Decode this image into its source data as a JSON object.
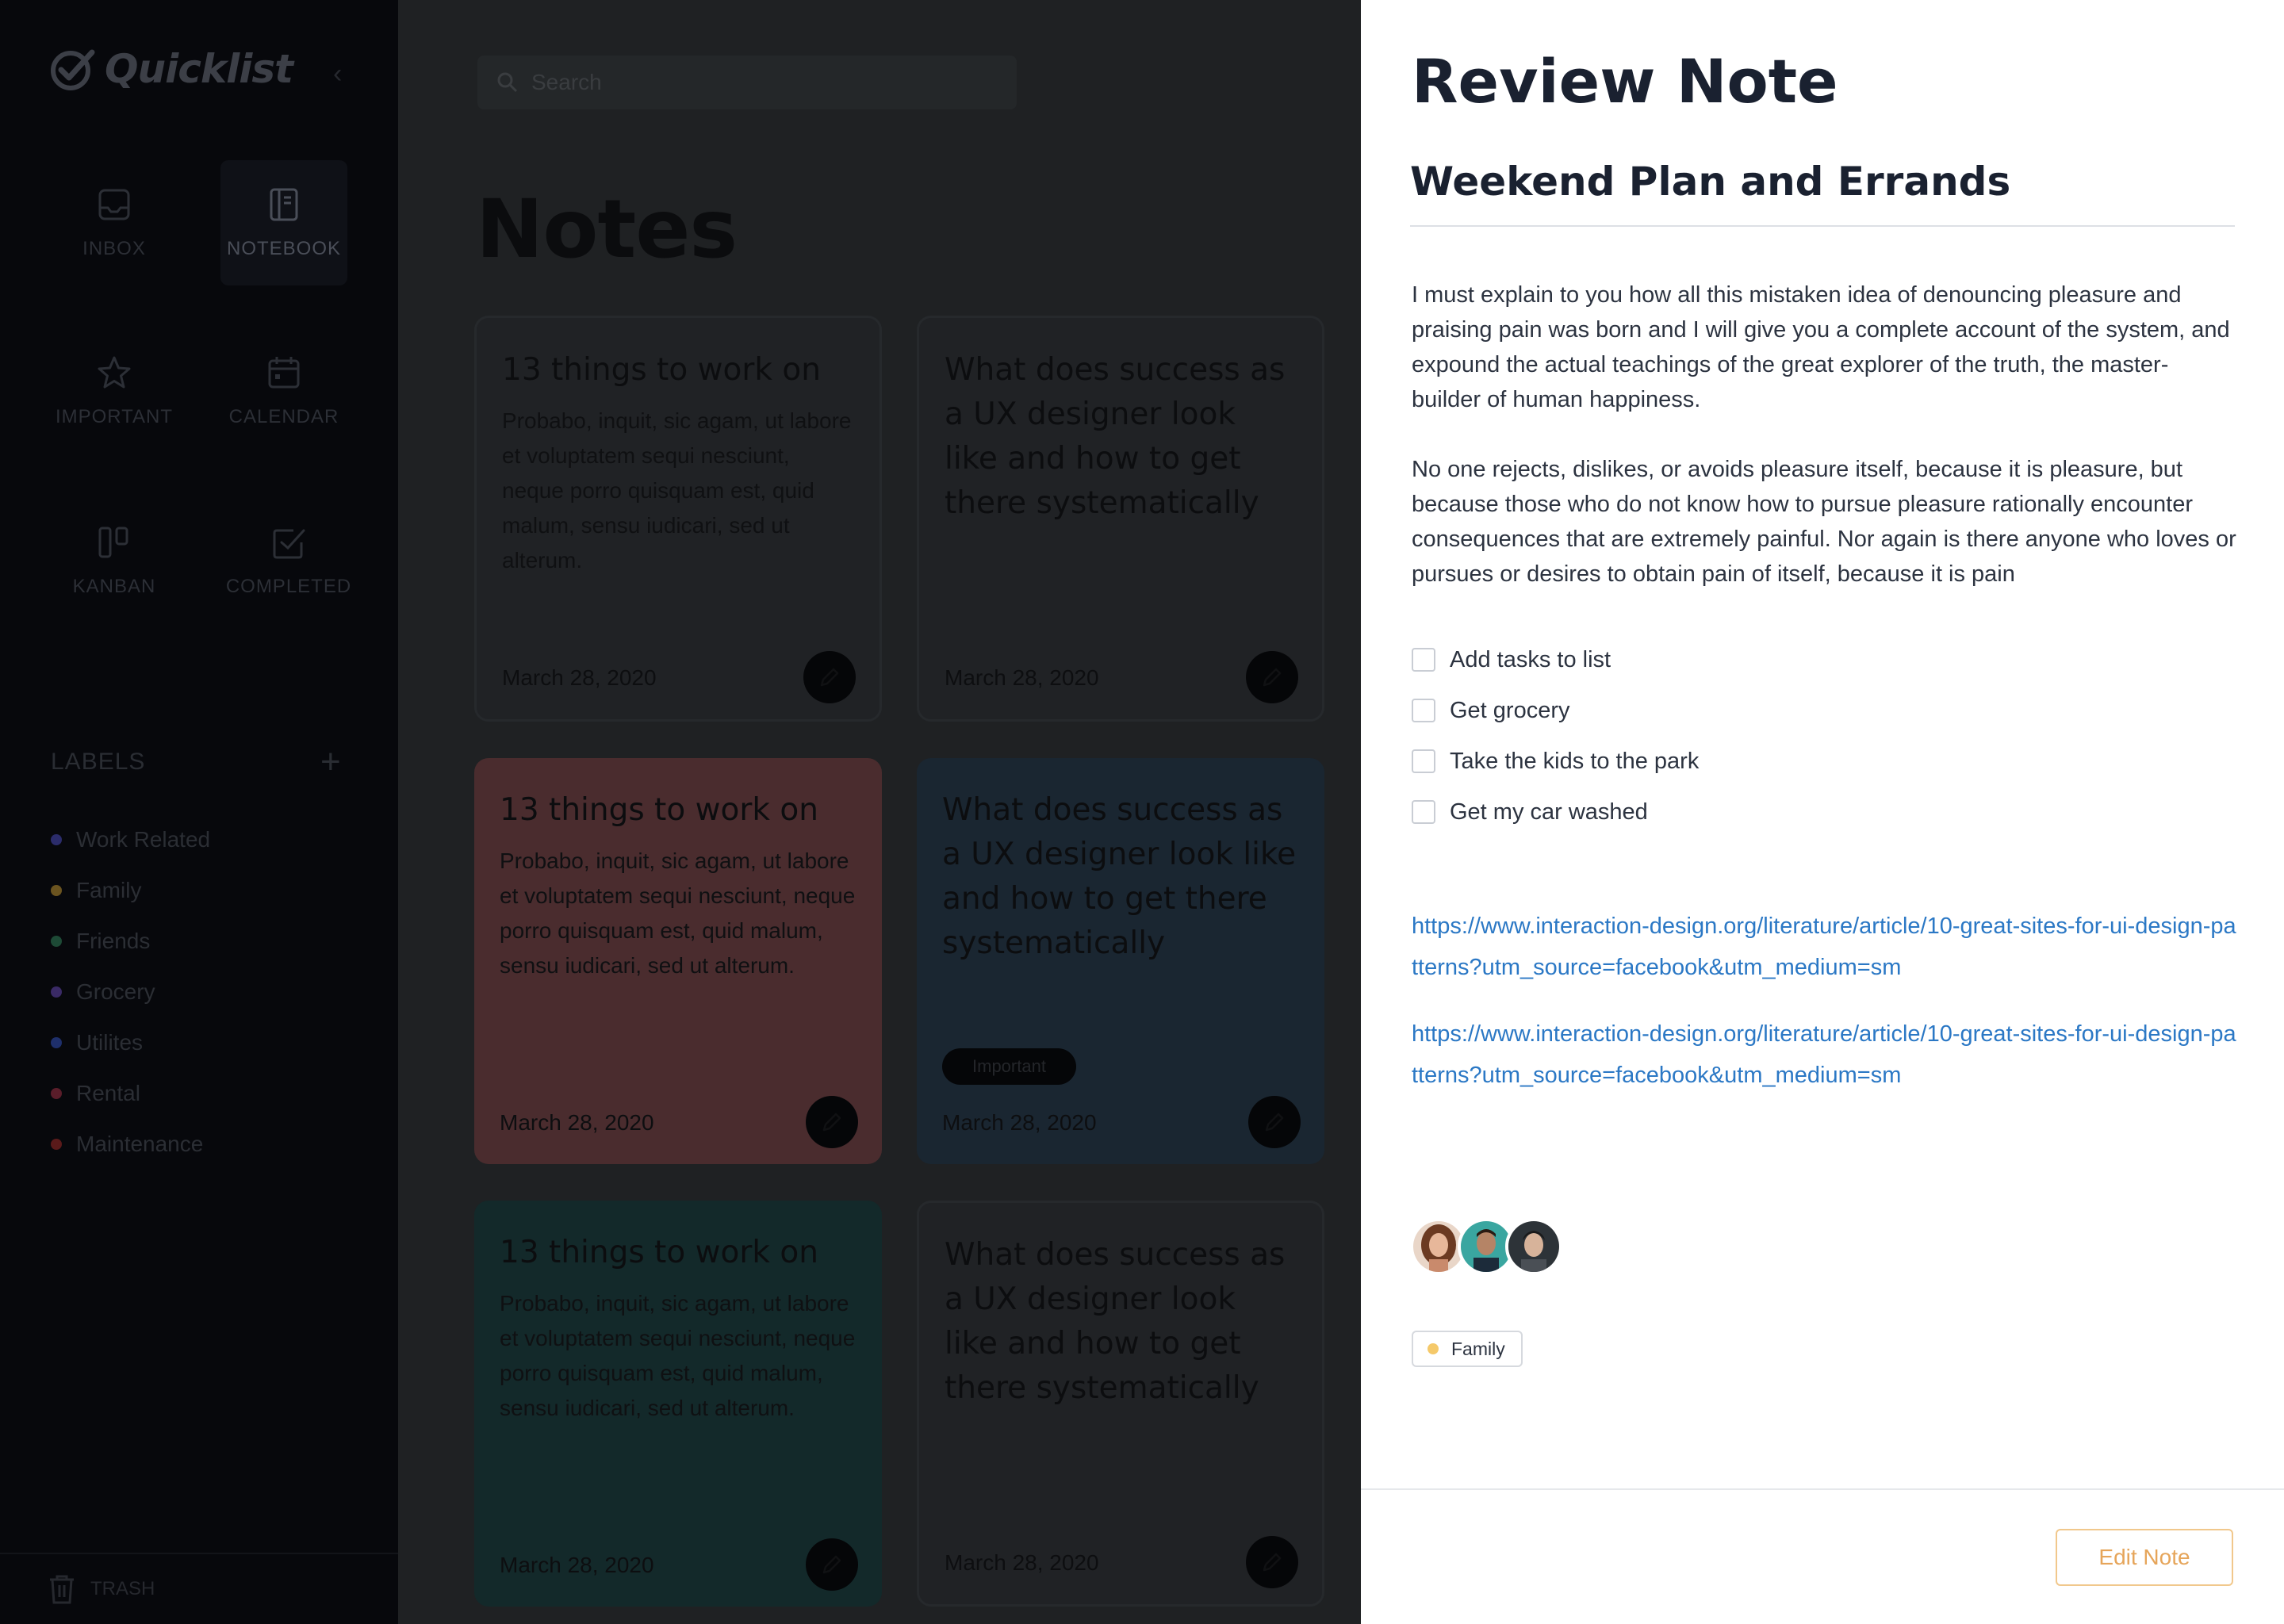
{
  "app": {
    "name": "Quicklist"
  },
  "sidebar": {
    "nav": [
      {
        "label": "INBOX",
        "icon": "inbox-icon",
        "active": false
      },
      {
        "label": "NOTEBOOK",
        "icon": "notebook-icon",
        "active": true
      },
      {
        "label": "IMPORTANT",
        "icon": "star-icon",
        "active": false
      },
      {
        "label": "CALENDAR",
        "icon": "calendar-icon",
        "active": false
      },
      {
        "label": "KANBAN",
        "icon": "kanban-icon",
        "active": false
      },
      {
        "label": "COMPLETED",
        "icon": "check-square-icon",
        "active": false
      }
    ],
    "labels_heading": "LABELS",
    "labels": [
      {
        "name": "Work Related",
        "color": "#2b2c6b"
      },
      {
        "name": "Family",
        "color": "#6b5420"
      },
      {
        "name": "Friends",
        "color": "#1d4a36"
      },
      {
        "name": "Grocery",
        "color": "#3a2a66"
      },
      {
        "name": "Utilites",
        "color": "#1e2f6b"
      },
      {
        "name": "Rental",
        "color": "#5a1d2a"
      },
      {
        "name": "Maintenance",
        "color": "#5a1a1a"
      }
    ],
    "trash_label": "TRASH"
  },
  "main": {
    "search_placeholder": "Search",
    "title": "Notes",
    "cards": [
      {
        "title": "13 things to work on",
        "body": "Probabo, inquit, sic agam, ut labore et voluptatem sequi nesciunt, neque porro quisquam est, quid malum, sensu iudicari, sed ut alterum.",
        "date": "March 28, 2020",
        "tag": "",
        "color": "plain"
      },
      {
        "title": "What does success as a UX designer look like and how to get there systematically",
        "body": "",
        "date": "March 28, 2020",
        "tag": "",
        "color": "plain"
      },
      {
        "title": "13 things to work on",
        "body": "Probabo, inquit, sic agam, ut labore et voluptatem sequi nesciunt, neque porro quisquam est, quid malum, sensu iudicari, sed ut alterum.",
        "date": "March 28, 2020",
        "tag": "",
        "color": "rose"
      },
      {
        "title": "What does success as a UX designer look like and how to get there systematically",
        "body": "",
        "date": "March 28, 2020",
        "tag": "Important",
        "color": "blue"
      },
      {
        "title": "13 things to work on",
        "body": "Probabo, inquit, sic agam, ut labore et voluptatem sequi nesciunt, neque porro quisquam est, quid malum, sensu iudicari, sed ut alterum.",
        "date": "March 28, 2020",
        "tag": "",
        "color": "teal"
      },
      {
        "title": "What does success as a UX designer look like and how to get there systematically",
        "body": "",
        "date": "March 28, 2020",
        "tag": "",
        "color": "plain"
      }
    ]
  },
  "panel": {
    "heading": "Review Note",
    "note_title": "Weekend Plan and Errands",
    "paragraphs": [
      "I must explain to you how all this mistaken idea of denouncing pleasure and praising pain was born and I will give you a complete account of the system, and expound the actual teachings of the great explorer of the truth, the master-builder of human happiness.",
      "No one rejects, dislikes, or avoids pleasure itself, because it is pleasure, but because those who do not know how to pursue pleasure rationally encounter consequences that are extremely painful. Nor again is there anyone who loves or pursues or desires to obtain pain of itself, because it is pain"
    ],
    "checklist": [
      "Add tasks to list",
      "Get grocery",
      "Take the kids to the park",
      "Get my car washed"
    ],
    "links": [
      "https://www.interaction-design.org/literature/article/10-great-sites-for-ui-design-patterns?utm_source=facebook&utm_medium=sm",
      "https://www.interaction-design.org/literature/article/10-great-sites-for-ui-design-patterns?utm_source=facebook&utm_medium=sm"
    ],
    "label": "Family",
    "edit_button": "Edit Note"
  }
}
